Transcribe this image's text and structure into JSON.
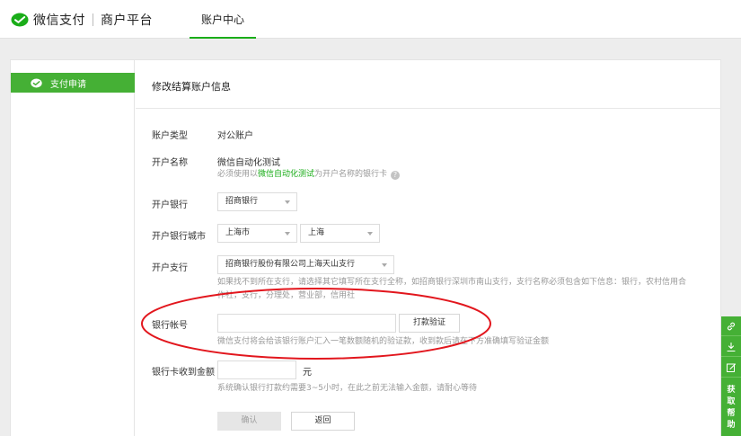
{
  "brand": {
    "name": "微信支付",
    "platform": "商户平台",
    "color": "#1aad19"
  },
  "nav": {
    "active_tab": "账户中心"
  },
  "sidebar": {
    "items": [
      {
        "label": "支付申请",
        "icon": "wechat-pay-icon"
      }
    ]
  },
  "page": {
    "title": "修改结算账户信息"
  },
  "form": {
    "account_type": {
      "label": "账户类型",
      "value": "对公账户"
    },
    "account_name": {
      "label": "开户名称",
      "value": "微信自动化测试",
      "hint_prefix": "必须使用以",
      "hint_highlight": "微信自动化测试",
      "hint_suffix": "为开户名称的银行卡",
      "help_icon": "?"
    },
    "bank": {
      "label": "开户银行",
      "value": "招商银行"
    },
    "bank_city": {
      "label": "开户银行城市",
      "province": "上海市",
      "city": "上海"
    },
    "branch": {
      "label": "开户支行",
      "value": "招商银行股份有限公司上海天山支行",
      "hint_line1": "如果找不到所在支行，请选择其它填写所在支行全称，如招商银行深圳市南山支行，支行名称必须包含如下信息：银行，农村信用合",
      "hint_line2": "作社，支行，分理处，营业部，信用社"
    },
    "account_number": {
      "label": "银行帐号",
      "value": "",
      "verify_button": "打款验证",
      "hint": "微信支付将会给该银行账户汇入一笔数额随机的验证款，收到款后请在下方准确填写验证金额"
    },
    "received_amount": {
      "label": "银行卡收到金额",
      "value": "",
      "unit": "元",
      "hint": "系统确认银行打款约需要3~5小时，在此之前无法输入金额，请耐心等待"
    },
    "confirm_button": "确认",
    "back_button": "返回"
  },
  "help_panel": {
    "buttons": [
      "link-icon",
      "download-icon",
      "edit-icon"
    ],
    "label": "获取帮助"
  },
  "annotation_color": "#e2161d"
}
